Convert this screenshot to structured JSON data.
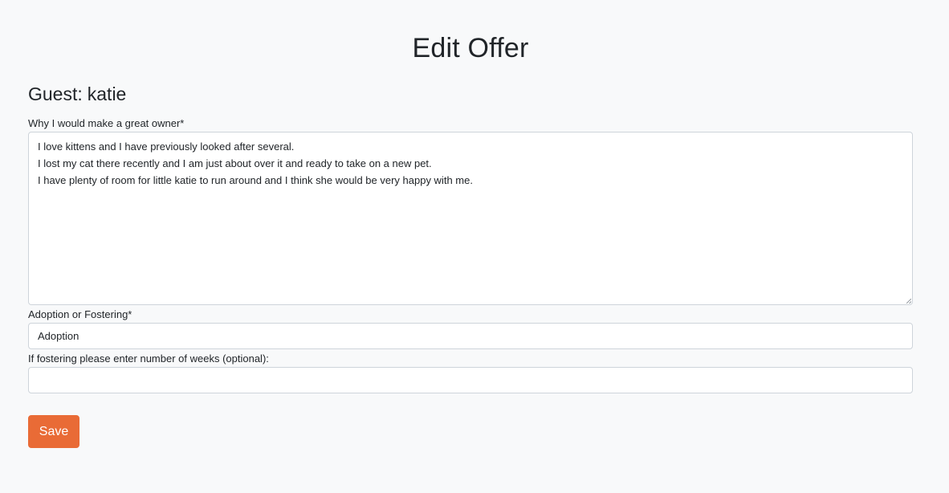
{
  "page": {
    "title": "Edit Offer"
  },
  "guest": {
    "label": "Guest:",
    "name": "katie"
  },
  "form": {
    "reason": {
      "label": "Why I would make a great owner*",
      "lines": [
        "I love kittens and I have previously looked after several.",
        "I lost my cat there recently and I am just about over it and ready to take on a new pet.",
        "I have plenty of room for little katie to run around and I think she would be very happy with me."
      ]
    },
    "type": {
      "label": "Adoption or Fostering*",
      "value": "Adoption"
    },
    "weeks": {
      "label": "If fostering please enter number of weeks (optional):",
      "value": ""
    },
    "save_label": "Save"
  },
  "colors": {
    "background": "#f8f9fa",
    "accent": "#e96b36",
    "border": "#ced4da",
    "text": "#212529"
  }
}
